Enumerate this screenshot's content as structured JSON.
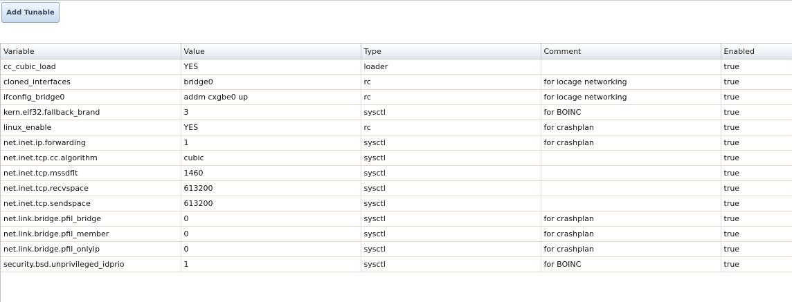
{
  "toolbar": {
    "add_label": "Add Tunable"
  },
  "table": {
    "columns": [
      "Variable",
      "Value",
      "Type",
      "Comment",
      "Enabled"
    ],
    "rows": [
      [
        "cc_cubic_load",
        "YES",
        "loader",
        "",
        "true"
      ],
      [
        "cloned_interfaces",
        "bridge0",
        "rc",
        "for iocage networking",
        "true"
      ],
      [
        "ifconfig_bridge0",
        "addm cxgbe0 up",
        "rc",
        "for iocage networking",
        "true"
      ],
      [
        "kern.elf32.fallback_brand",
        "3",
        "sysctl",
        "for BOINC",
        "true"
      ],
      [
        "linux_enable",
        "YES",
        "rc",
        "for crashplan",
        "true"
      ],
      [
        "net.inet.ip.forwarding",
        "1",
        "sysctl",
        "for crashplan",
        "true"
      ],
      [
        "net.inet.tcp.cc.algorithm",
        "cubic",
        "sysctl",
        "",
        "true"
      ],
      [
        "net.inet.tcp.mssdflt",
        "1460",
        "sysctl",
        "",
        "true"
      ],
      [
        "net.inet.tcp.recvspace",
        "613200",
        "sysctl",
        "",
        "true"
      ],
      [
        "net.inet.tcp.sendspace",
        "613200",
        "sysctl",
        "",
        "true"
      ],
      [
        "net.link.bridge.pfil_bridge",
        "0",
        "sysctl",
        "for crashplan",
        "true"
      ],
      [
        "net.link.bridge.pfil_member",
        "0",
        "sysctl",
        "for crashplan",
        "true"
      ],
      [
        "net.link.bridge.pfil_onlyip",
        "0",
        "sysctl",
        "for crashplan",
        "true"
      ],
      [
        "security.bsd.unprivileged_idprio",
        "1",
        "sysctl",
        "for BOINC",
        "true"
      ]
    ]
  }
}
